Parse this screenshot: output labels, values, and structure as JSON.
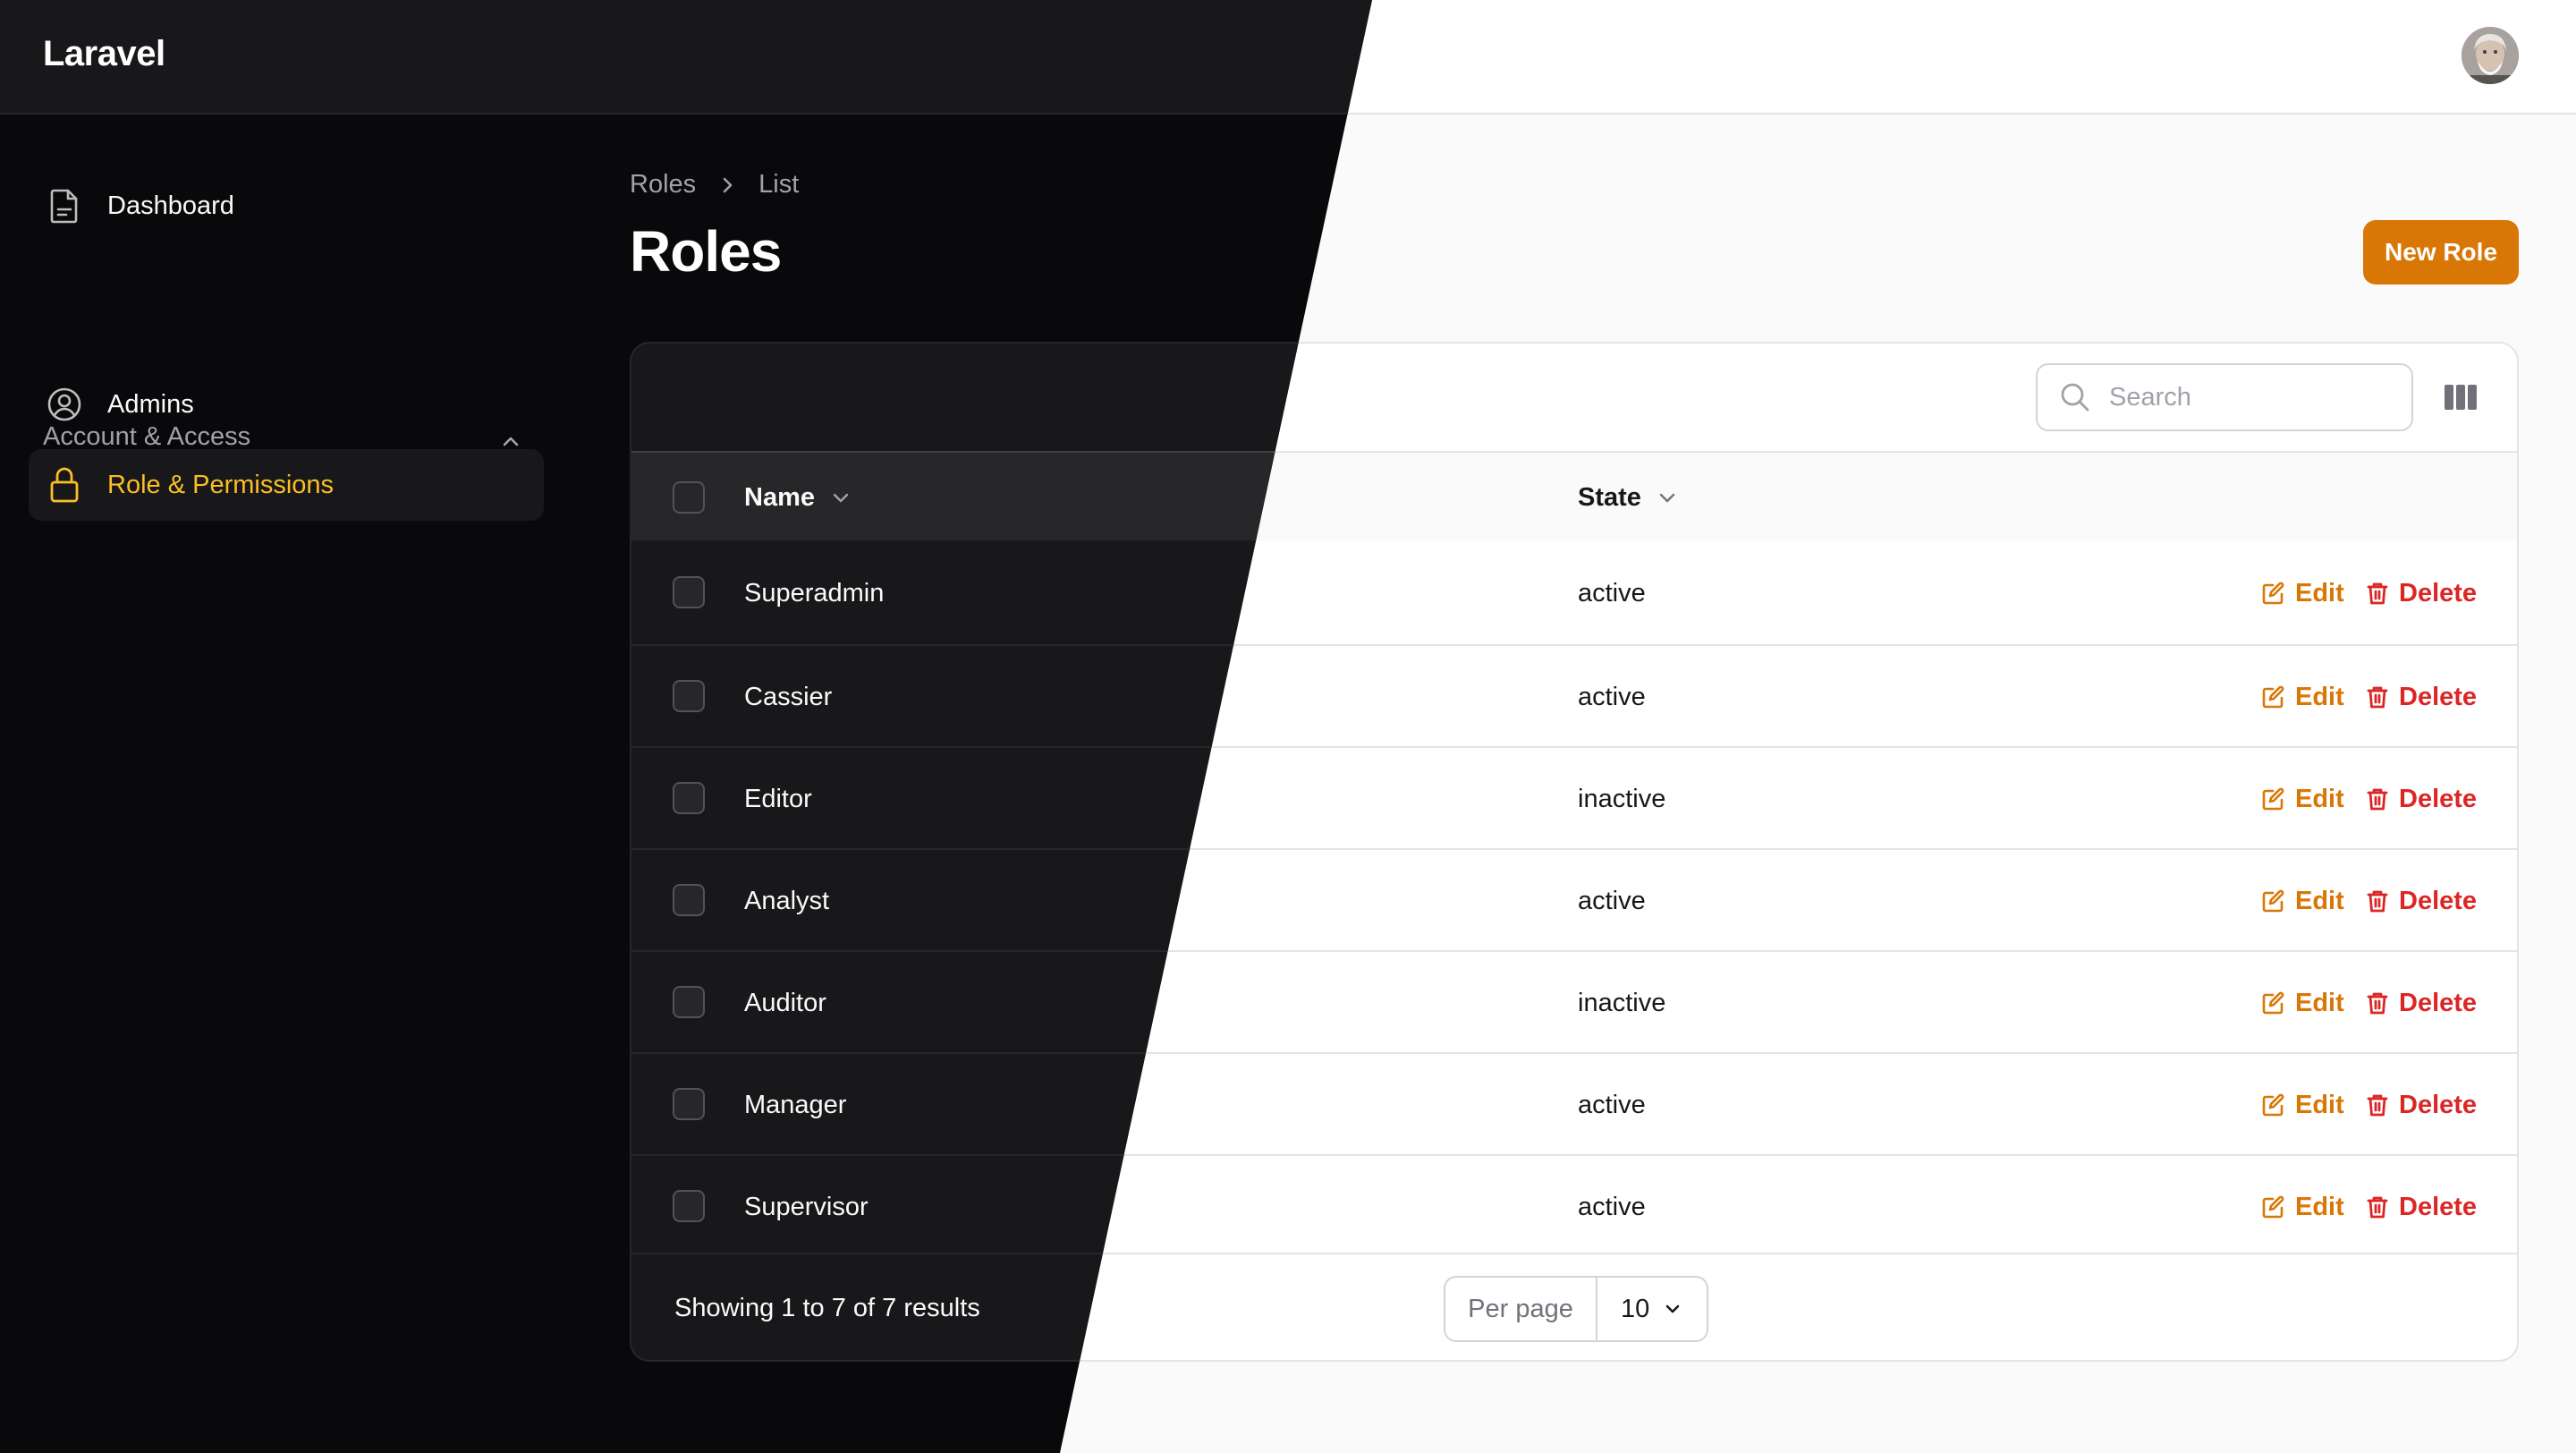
{
  "app": {
    "title": "Laravel"
  },
  "sidebar": {
    "dashboard": {
      "label": "Dashboard",
      "icon": "document-icon"
    },
    "group": {
      "label": "Account & Access",
      "icon": "chevron-up-icon"
    },
    "items": [
      {
        "label": "Admins",
        "icon": "user-circle-icon",
        "active": false
      },
      {
        "label": "Role & Permissions",
        "icon": "lock-icon",
        "active": true
      }
    ]
  },
  "breadcrumb": {
    "root": "Roles",
    "current": "List"
  },
  "page": {
    "title": "Roles",
    "new_button": "New Role"
  },
  "table": {
    "search_placeholder": "Search",
    "columns": {
      "name": "Name",
      "state": "State"
    },
    "rows": [
      {
        "name": "Superadmin",
        "state": "active"
      },
      {
        "name": "Cassier",
        "state": "active"
      },
      {
        "name": "Editor",
        "state": "inactive"
      },
      {
        "name": "Analyst",
        "state": "active"
      },
      {
        "name": "Auditor",
        "state": "inactive"
      },
      {
        "name": "Manager",
        "state": "active"
      },
      {
        "name": "Supervisor",
        "state": "active"
      }
    ],
    "actions": {
      "edit": "Edit",
      "delete": "Delete"
    },
    "footer": {
      "summary": "Showing 1 to 7 of 7 results",
      "per_page_label": "Per page",
      "per_page_value": "10"
    }
  },
  "colors": {
    "primary": "#d97706",
    "primary_dark": "#fbbf24",
    "danger": "#dc2626"
  }
}
